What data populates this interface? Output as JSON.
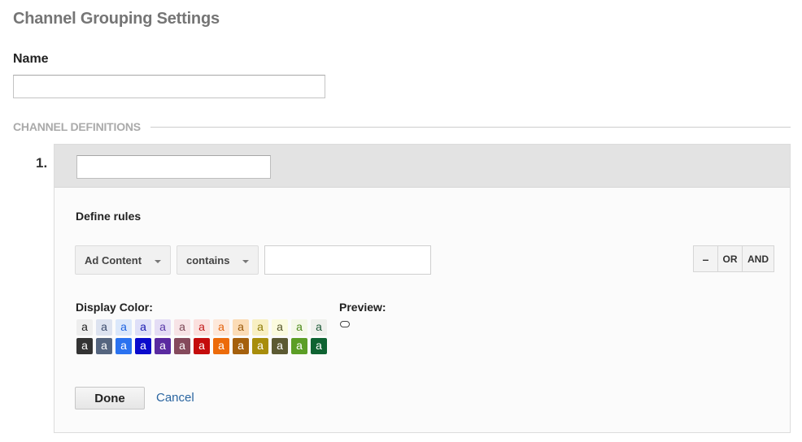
{
  "header": {
    "title": "Channel Grouping Settings"
  },
  "name_field": {
    "label": "Name",
    "value": "",
    "placeholder": ""
  },
  "section": {
    "title": "CHANNEL DEFINITIONS"
  },
  "definitions": [
    {
      "number": "1.",
      "name_value": "",
      "rules_title": "Define rules",
      "rule": {
        "dimension": "Ad Content",
        "operator": "contains",
        "value": ""
      },
      "rule_buttons": {
        "remove": "–",
        "or": "OR",
        "and": "AND"
      },
      "display_color_label": "Display Color:",
      "preview_label": "Preview:",
      "swatch_glyph": "a",
      "swatches_light": [
        {
          "bg": "#eeeeee",
          "fg": "#222222"
        },
        {
          "bg": "#dde3f0",
          "fg": "#3c4c6c"
        },
        {
          "bg": "#dbe8fb",
          "fg": "#1f64e0"
        },
        {
          "bg": "#dedff8",
          "fg": "#1a1ab0"
        },
        {
          "bg": "#e4ddf5",
          "fg": "#5a3aa8"
        },
        {
          "bg": "#f7e3e6",
          "fg": "#7c4858"
        },
        {
          "bg": "#fbe0de",
          "fg": "#c21b1b"
        },
        {
          "bg": "#fde8da",
          "fg": "#e4640e"
        },
        {
          "bg": "#fbdcb6",
          "fg": "#9a5a0c"
        },
        {
          "bg": "#f8efc2",
          "fg": "#8e7c0a"
        },
        {
          "bg": "#fbfbde",
          "fg": "#55562a"
        },
        {
          "bg": "#f4f8e8",
          "fg": "#4c8a1a"
        },
        {
          "bg": "#eef0ec",
          "fg": "#1e5a38"
        }
      ],
      "swatches_dark": [
        {
          "bg": "#333333",
          "fg": "#ffffff"
        },
        {
          "bg": "#55657f",
          "fg": "#ffffff"
        },
        {
          "bg": "#2a72f0",
          "fg": "#ffffff"
        },
        {
          "bg": "#0a0acc",
          "fg": "#ffffff"
        },
        {
          "bg": "#5a2aa0",
          "fg": "#ffffff"
        },
        {
          "bg": "#854a5c",
          "fg": "#ffffff"
        },
        {
          "bg": "#c40c0c",
          "fg": "#ffffff"
        },
        {
          "bg": "#ec6b0a",
          "fg": "#ffffff"
        },
        {
          "bg": "#a5600c",
          "fg": "#ffffff"
        },
        {
          "bg": "#a88d0a",
          "fg": "#ffffff"
        },
        {
          "bg": "#5c5a32",
          "fg": "#ffffff"
        },
        {
          "bg": "#5c9e26",
          "fg": "#ffffff"
        },
        {
          "bg": "#0e6332",
          "fg": "#ffffff"
        }
      ],
      "done_label": "Done",
      "cancel_label": "Cancel"
    }
  ]
}
